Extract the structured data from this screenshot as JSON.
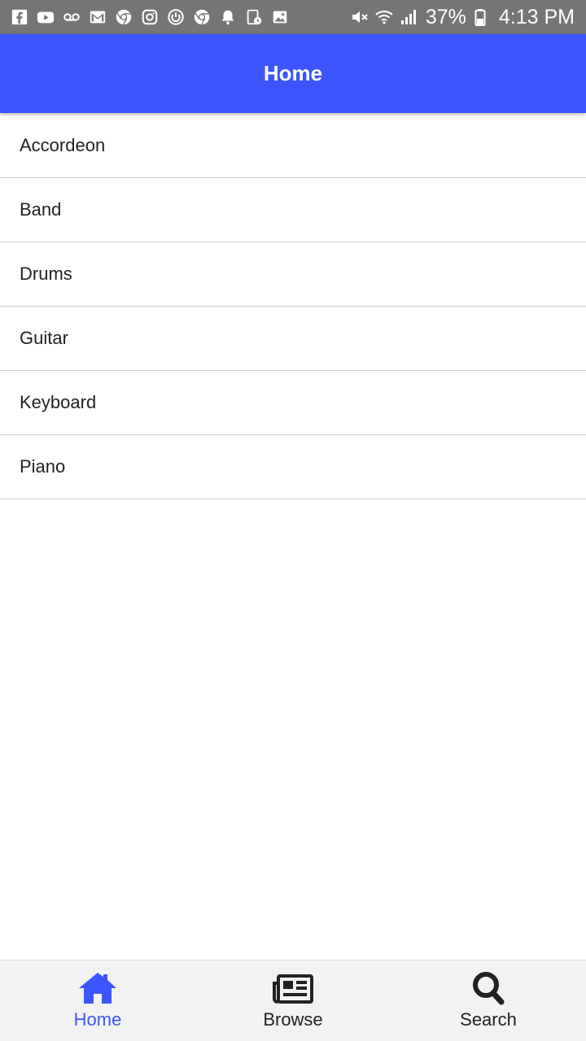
{
  "status_bar": {
    "left_icons": [
      "facebook-icon",
      "youtube-icon",
      "voicemail-icon",
      "gmail-icon",
      "chrome-icon",
      "instagram-icon",
      "power-app-icon",
      "chrome-icon",
      "notification-bell-icon",
      "calendar-icon",
      "image-icon"
    ],
    "right_icons": [
      "mute-icon",
      "wifi-icon",
      "signal-icon"
    ],
    "battery_percent": "37%",
    "time": "4:13 PM"
  },
  "app_bar": {
    "title": "Home"
  },
  "list": {
    "items": [
      {
        "label": "Accordeon"
      },
      {
        "label": "Band"
      },
      {
        "label": "Drums"
      },
      {
        "label": "Guitar"
      },
      {
        "label": "Keyboard"
      },
      {
        "label": "Piano"
      }
    ]
  },
  "bottom_nav": {
    "tabs": [
      {
        "label": "Home",
        "icon": "home-icon",
        "active": true
      },
      {
        "label": "Browse",
        "icon": "newspaper-icon",
        "active": false
      },
      {
        "label": "Search",
        "icon": "search-icon",
        "active": false
      }
    ]
  },
  "colors": {
    "accent": "#3d55ff",
    "status_bar": "#757575",
    "nav_background": "#f2f2f2"
  }
}
